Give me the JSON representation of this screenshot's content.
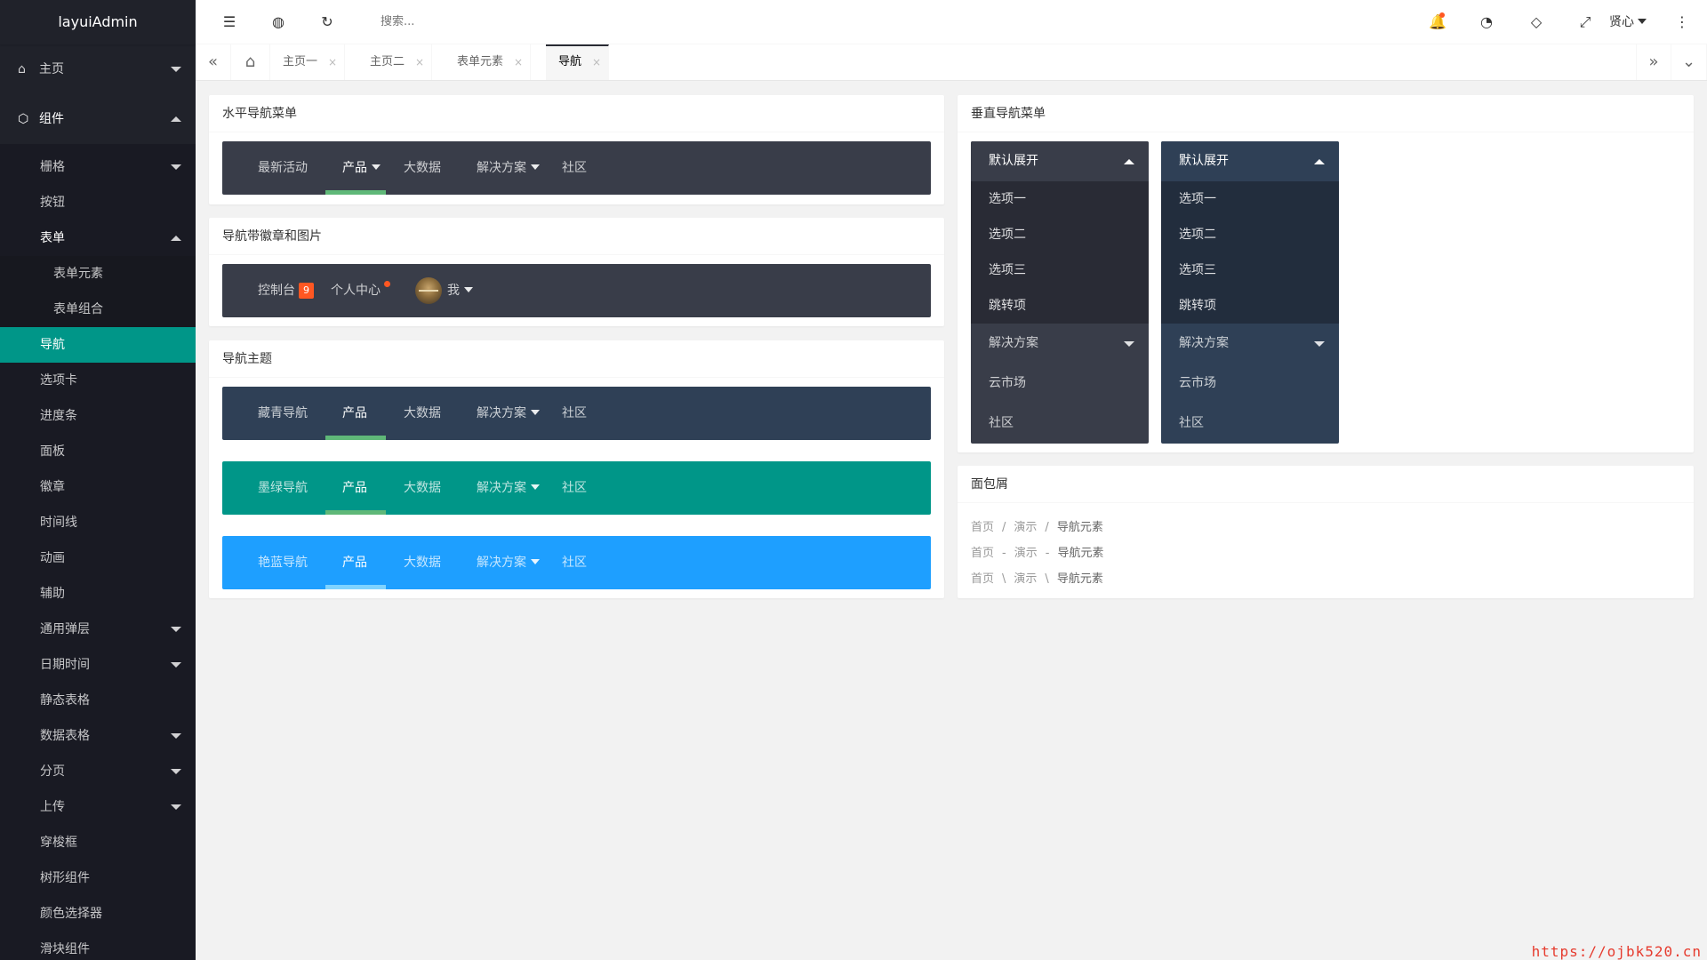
{
  "app": {
    "title": "layuiAdmin"
  },
  "sidebar": {
    "home": "主页",
    "components": "组件",
    "grid": "栅格",
    "button": "按钮",
    "form": "表单",
    "form_elements": "表单元素",
    "form_combo": "表单组合",
    "items": [
      "导航",
      "选项卡",
      "进度条",
      "面板",
      "徽章",
      "时间线",
      "动画",
      "辅助",
      "通用弹层",
      "日期时间",
      "静态表格",
      "数据表格",
      "分页",
      "上传",
      "穿梭框",
      "树形组件",
      "颜色选择器",
      "滑块组件"
    ],
    "active": "导航"
  },
  "header": {
    "search_placeholder": "搜索...",
    "user": "贤心",
    "icons": [
      "menu-fold-icon",
      "website-icon",
      "refresh-icon",
      "bell-icon",
      "theme-icon",
      "note-icon",
      "fullscreen-icon",
      "more-icon"
    ]
  },
  "tabs": {
    "items": [
      "主页一",
      "主页二",
      "表单元素",
      "导航"
    ],
    "active": "导航"
  },
  "cards": {
    "horizontal": {
      "title": "水平导航菜单",
      "items": [
        "最新活动",
        "产品",
        "大数据",
        "解决方案",
        "社区"
      ]
    },
    "badge": {
      "title": "导航带徽章和图片",
      "console": "控制台",
      "console_badge": "9",
      "profile": "个人中心",
      "me": "我"
    },
    "theme": {
      "title": "导航主题",
      "navs": [
        {
          "label": "藏青导航",
          "items": [
            "产品",
            "大数据",
            "解决方案",
            "社区"
          ],
          "bg": "#2f4056",
          "bar": "#5fb878"
        },
        {
          "label": "墨绿导航",
          "items": [
            "产品",
            "大数据",
            "解决方案",
            "社区"
          ],
          "bg": "#009688",
          "bar": "#5fb878"
        },
        {
          "label": "艳蓝导航",
          "items": [
            "产品",
            "大数据",
            "解决方案",
            "社区"
          ],
          "bg": "#1e9fff",
          "bar": "#7fd3ff"
        }
      ]
    },
    "vertical": {
      "title": "垂直导航菜单",
      "menus": [
        {
          "head": "默认展开",
          "sub": [
            "选项一",
            "选项二",
            "选项三",
            "跳转项"
          ],
          "items": [
            "解决方案",
            "云市场",
            "社区"
          ]
        },
        {
          "head": "默认展开",
          "sub": [
            "选项一",
            "选项二",
            "选项三",
            "跳转项"
          ],
          "items": [
            "解决方案",
            "云市场",
            "社区"
          ]
        }
      ]
    },
    "breadcrumb": {
      "title": "面包屑",
      "rows": [
        {
          "items": [
            "首页",
            "演示",
            "导航元素"
          ],
          "sep": "/"
        },
        {
          "items": [
            "首页",
            "演示",
            "导航元素"
          ],
          "sep": "-"
        },
        {
          "items": [
            "首页",
            "演示",
            "导航元素"
          ],
          "sep": "\\"
        }
      ]
    }
  },
  "colors": {
    "sidebar": "#20222a",
    "active": "#009688",
    "nav_dark": "#393d49",
    "bar": "#5fb878"
  },
  "watermark": "https://ojbk520.cn"
}
